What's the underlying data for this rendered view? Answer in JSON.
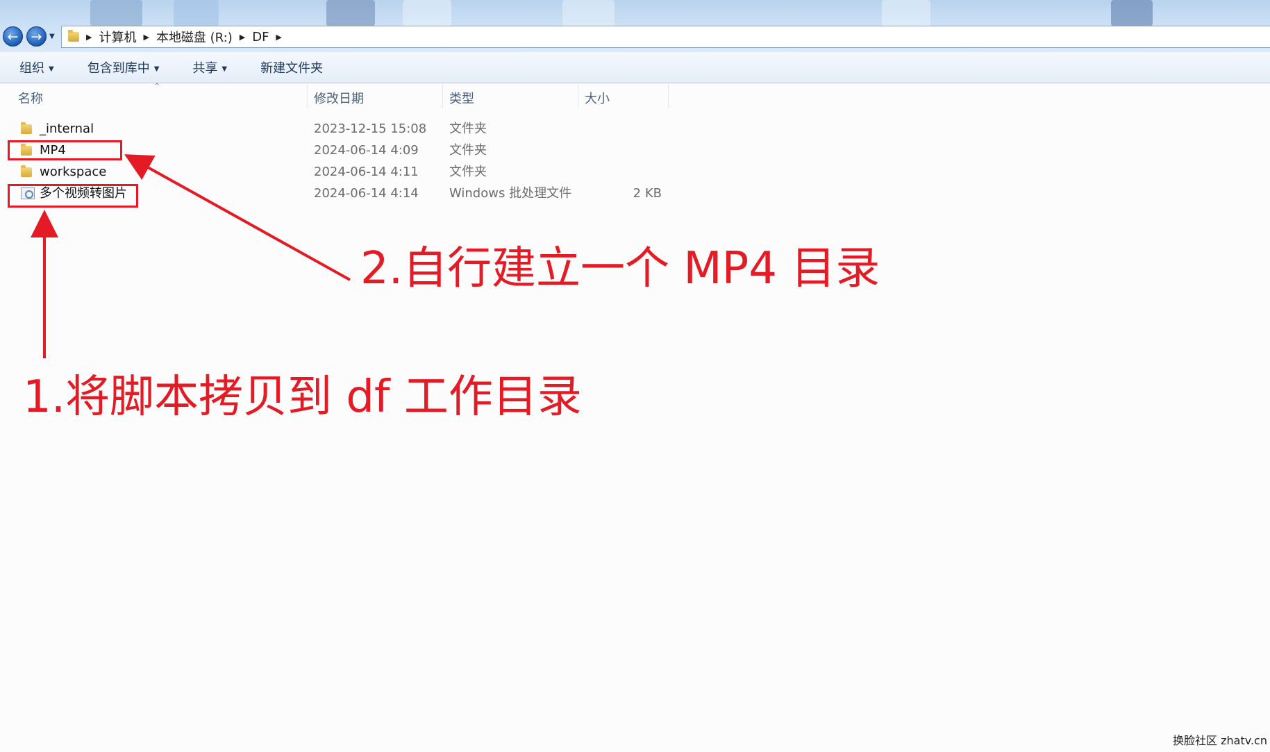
{
  "address_bar": {
    "crumbs": [
      "计算机",
      "本地磁盘 (R:)",
      "DF"
    ]
  },
  "toolbar": {
    "organize": "组织",
    "include_in_library": "包含到库中",
    "share": "共享",
    "new_folder": "新建文件夹"
  },
  "columns": {
    "name": "名称",
    "date_modified": "修改日期",
    "type": "类型",
    "size": "大小"
  },
  "files": [
    {
      "name": "_internal",
      "date": "2023-12-15 15:08",
      "type": "文件夹",
      "size": "",
      "icon": "folder-icon"
    },
    {
      "name": "MP4",
      "date": "2024-06-14 4:09",
      "type": "文件夹",
      "size": "",
      "icon": "folder-icon"
    },
    {
      "name": "workspace",
      "date": "2024-06-14 4:11",
      "type": "文件夹",
      "size": "",
      "icon": "folder-icon"
    },
    {
      "name": "多个视频转图片",
      "date": "2024-06-14 4:14",
      "type": "Windows 批处理文件",
      "size": "2 KB",
      "icon": "batch-file-icon"
    }
  ],
  "annotations": {
    "step1": "1.将脚本拷贝到 df 工作目录",
    "step2": "2.自行建立一个 MP4 目录",
    "color": "#e41b25"
  },
  "watermark": "换脸社区 zhatv.cn"
}
